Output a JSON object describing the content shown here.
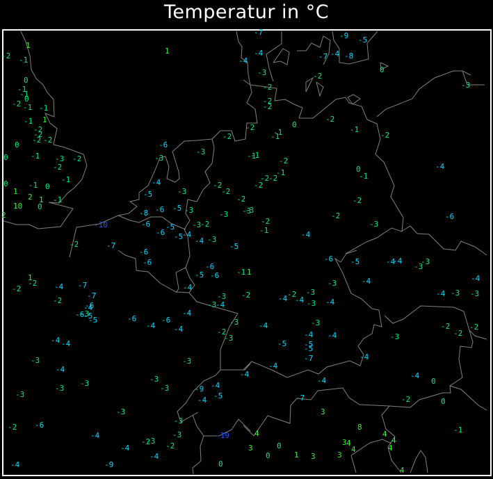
{
  "title": "Temperatur in °C",
  "colors": {
    "warm": "#33ee33",
    "mild": "#00e68a",
    "cold": "#00d8ff",
    "very_cold": "#2050ff",
    "coast": "#808080",
    "frame": "#ffffff"
  },
  "stations": [
    "-2",
    "1",
    "-1",
    "1",
    "0",
    "-1",
    "-1",
    "0",
    "-2",
    "-1",
    "-1",
    "-1",
    "1",
    "-2",
    "-2",
    "-2",
    "-2",
    "0",
    "0",
    "-1",
    "-3",
    "-2",
    "-2",
    "-1",
    "0",
    "-1",
    "0",
    "1",
    "2",
    "1",
    "-1",
    "10",
    "0",
    "2",
    "-2",
    "-6",
    "-3",
    "-3",
    "-2",
    "-4",
    "-3",
    "-5",
    "-8",
    "-6",
    "-5",
    "-3",
    "-10",
    "-6",
    "-5",
    "-6",
    "-3",
    "-2",
    "-5",
    "-4",
    "-4",
    "-3",
    "-2",
    "-2",
    "-2",
    "-3",
    "-3",
    "-1",
    "-5",
    "-7",
    "-6",
    "-6",
    "-7",
    "-9",
    "-5",
    "-4",
    "-7",
    "-4",
    "-8",
    "-4",
    "-3",
    "-2",
    "0",
    "-2",
    "-2",
    "-2",
    "-3",
    "-2",
    "-1",
    "-1",
    "0",
    "-2",
    "-1",
    "-2",
    "-1",
    "-2",
    "-1",
    "-2",
    "-2",
    "-2",
    "0",
    "-1",
    "-4",
    "-2",
    "-2",
    "-3",
    "-6",
    "-2",
    "-1",
    "-4",
    "-3",
    "1",
    "-2",
    "-2",
    "-4",
    "-7",
    "-7",
    "-2",
    "-6",
    "-4",
    "-6",
    "-3",
    "-5",
    "-5",
    "-6",
    "-4",
    "-6",
    "-4",
    "-6",
    "-5",
    "-6",
    "-1",
    "1",
    "-4",
    "-3",
    "-3",
    "-4",
    "-4",
    "-2",
    "-3",
    "-2",
    "-3",
    "-4",
    "-4",
    "-3",
    "-4",
    "-3",
    "-3",
    "-3",
    "-3",
    "-3",
    "-3",
    "-9",
    "-4",
    "-5",
    "-4",
    "-3",
    "-3",
    "-2",
    "-6",
    "-4",
    "-3",
    "-19",
    "-2",
    "-3",
    "-4",
    "-2",
    "-4",
    "-4",
    "-9",
    "0",
    "-6",
    "-5",
    "-4",
    "-4",
    "-3",
    "-3",
    "-4",
    "-3",
    "-4",
    "-4",
    "-3",
    "-3",
    "-4",
    "-2",
    "-3",
    "-4",
    "-3",
    "-4",
    "-4",
    "-3",
    "-2",
    "-2",
    "-2",
    "-3",
    "-4",
    "-4",
    "-5",
    "-5",
    "-5",
    "-7",
    "-4",
    "-4",
    "-4",
    "-4",
    "-4",
    "0",
    "-2",
    "0",
    "-7",
    "3",
    "-1",
    "8",
    "4",
    "4",
    "3",
    "4",
    "4",
    "4",
    "3",
    "0",
    "0",
    "1",
    "3",
    "3",
    "4",
    "4"
  ]
}
